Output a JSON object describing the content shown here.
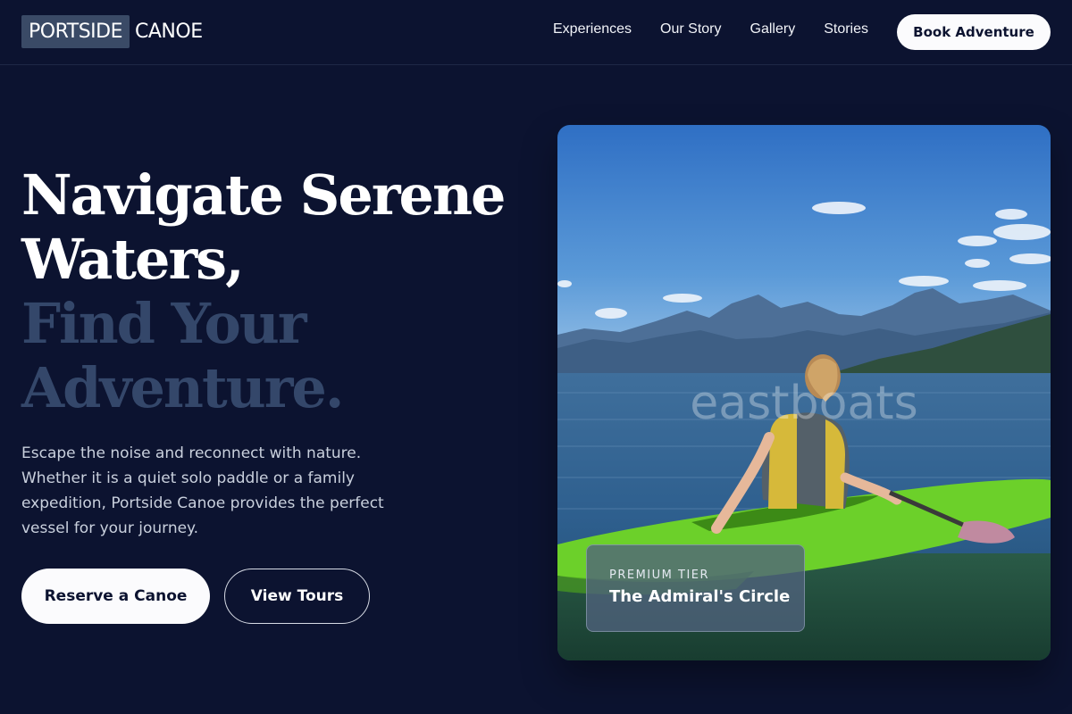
{
  "header": {
    "logo_box": "PORTSIDE",
    "logo_rest": "CANOE",
    "nav": [
      "Experiences",
      "Our Story",
      "Gallery",
      "Stories"
    ],
    "book_button": "Book Adventure"
  },
  "hero": {
    "headline_line1": "Navigate Serene",
    "headline_line2": "Waters,",
    "headline_line3": "Find Your",
    "headline_line4": "Adventure.",
    "description": "Escape the noise and reconnect with nature. Whether it is a quiet solo paddle or a family expedition, Portside Canoe provides the perfect vessel for your journey.",
    "primary_button": "Reserve a Canoe",
    "secondary_button": "View Tours"
  },
  "image": {
    "watermark": "eastboats",
    "tier_label": "PREMIUM TIER",
    "tier_title": "The Admiral's Circle"
  },
  "colors": {
    "background": "#0c1330",
    "headline_dim": "#34476a",
    "button_light": "#fbfbfd",
    "kayak_green": "#6cd02a"
  }
}
